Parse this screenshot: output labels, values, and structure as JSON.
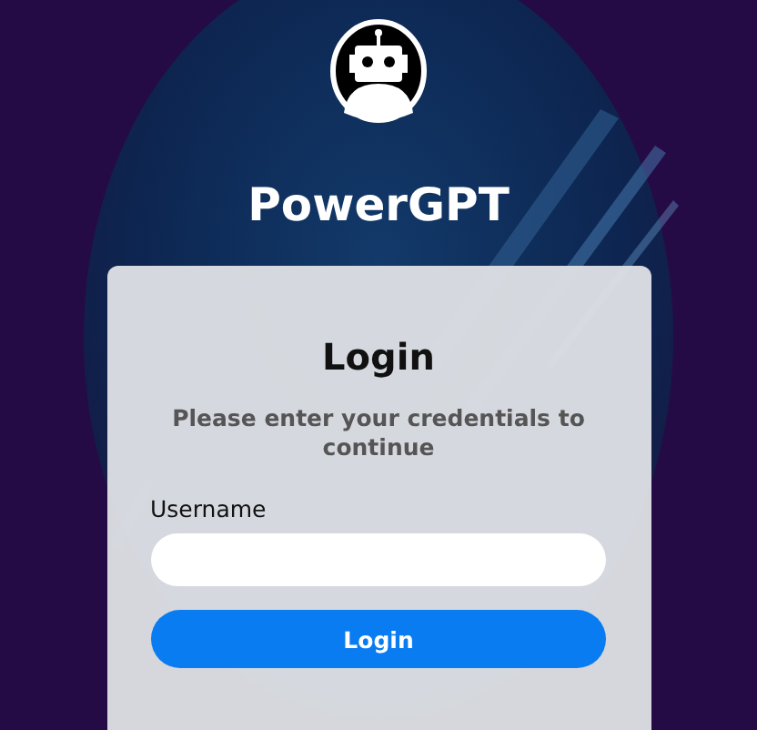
{
  "app": {
    "title": "PowerGPT"
  },
  "card": {
    "title": "Login",
    "subtitle": "Please enter your credentials to continue",
    "fields": [
      {
        "label": "Username"
      }
    ],
    "button": "Login"
  }
}
